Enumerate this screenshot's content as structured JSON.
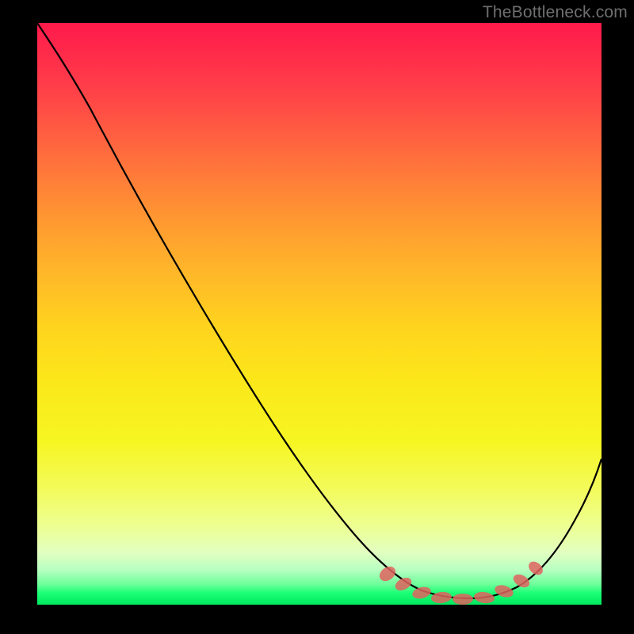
{
  "watermark": "TheBottleneck.com",
  "chart_data": {
    "type": "line",
    "title": "",
    "xlabel": "",
    "ylabel": "",
    "xlim": [
      0,
      100
    ],
    "ylim": [
      0,
      100
    ],
    "series": [
      {
        "name": "bottleneck-curve",
        "x": [
          0,
          6,
          12,
          18,
          24,
          30,
          36,
          42,
          48,
          54,
          60,
          64,
          68,
          72,
          75,
          78,
          81,
          84,
          88,
          92,
          96,
          100
        ],
        "y": [
          100,
          94,
          88,
          80,
          74,
          66,
          58,
          50,
          42,
          34,
          26,
          19,
          12,
          6,
          3,
          2,
          2,
          3,
          6,
          12,
          22,
          34
        ]
      }
    ],
    "markers": {
      "name": "recommended-zone",
      "x": [
        67,
        70,
        72,
        74,
        76,
        78,
        80,
        82,
        85,
        88
      ],
      "y": [
        7,
        4,
        3,
        2,
        1.5,
        1.5,
        2,
        2.5,
        4,
        7
      ]
    },
    "colors": {
      "curve": "#000000",
      "marker": "#e0635f",
      "gradient_top": "#ff1a4b",
      "gradient_mid": "#ffd31e",
      "gradient_bottom": "#00e85e"
    }
  }
}
